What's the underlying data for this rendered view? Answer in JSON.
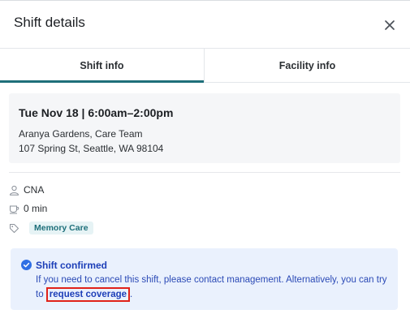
{
  "header": {
    "title": "Shift details",
    "close_icon": "close-icon"
  },
  "tabs": [
    {
      "label": "Shift info",
      "active": true
    },
    {
      "label": "Facility info",
      "active": false
    }
  ],
  "shift": {
    "date_time": "Tue Nov 18 | 6:00am–2:00pm",
    "facility": "Aranya Gardens, Care Team",
    "address": "107 Spring St, Seattle, WA 98104"
  },
  "details": {
    "role": "CNA",
    "break": "0 min",
    "tag": "Memory Care"
  },
  "notice": {
    "title": "Shift confirmed",
    "body": "If you need to cancel this shift, please contact management. Alternatively, you can try to",
    "link": "request coverage",
    "suffix": "."
  },
  "colors": {
    "accent": "#1e6f7a",
    "notice_bg": "#eaf1fd",
    "notice_text": "#1d3fb8",
    "highlight": "#e0221a"
  }
}
